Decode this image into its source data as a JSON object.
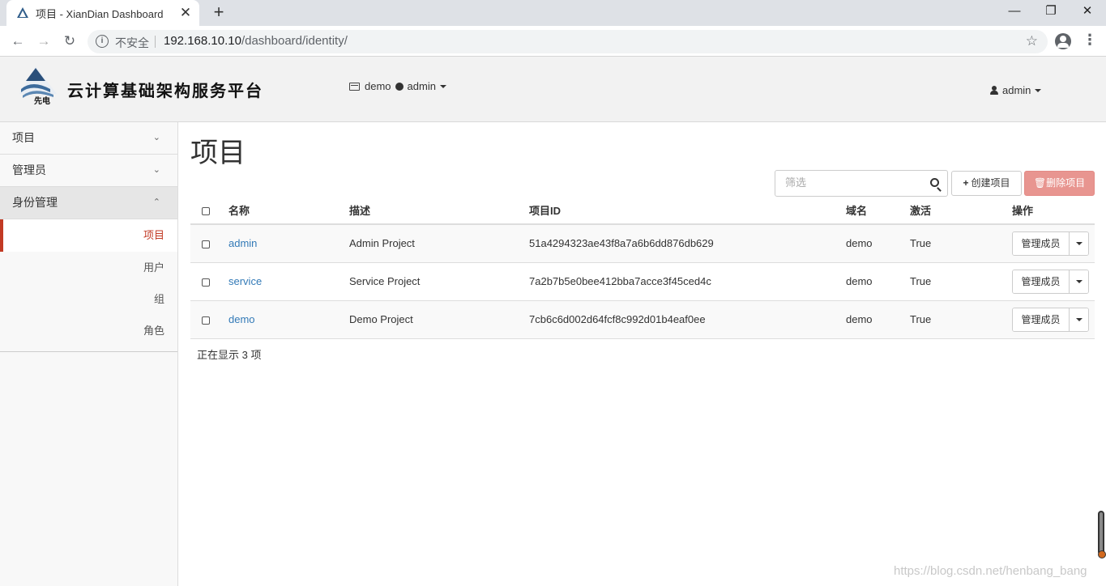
{
  "browser": {
    "tab_title": "项目 - XianDian Dashboard",
    "tab_close": "✕",
    "new_tab": "+",
    "window_minimize": "—",
    "window_restore": "❐",
    "window_close": "✕",
    "back": "←",
    "forward": "→",
    "reload": "↻",
    "security_label": "不安全",
    "url_host": "192.168.10.10",
    "url_path": "/dashboard/identity/",
    "bookmark": "☆",
    "menu": "⋮"
  },
  "header": {
    "brand": "云计算基础架构服务平台",
    "logo_text": "先电",
    "project": "demo",
    "region_user": "admin",
    "user": "admin"
  },
  "sidebar": {
    "sections": [
      {
        "label": "项目",
        "chevron": "⌄"
      },
      {
        "label": "管理员",
        "chevron": "⌄"
      },
      {
        "label": "身份管理",
        "chevron": "⌃"
      }
    ],
    "items": [
      {
        "label": "项目"
      },
      {
        "label": "用户"
      },
      {
        "label": "组"
      },
      {
        "label": "角色"
      }
    ]
  },
  "main": {
    "title": "项目",
    "filter_placeholder": "筛选",
    "create_label": "创建项目",
    "delete_label": "删除项目",
    "columns": [
      "名称",
      "描述",
      "项目ID",
      "域名",
      "激活",
      "操作"
    ],
    "rows": [
      {
        "name": "admin",
        "description": "Admin Project",
        "id": "51a4294323ae43f8a7a6b6dd876db629",
        "domain": "demo",
        "enabled": "True",
        "action": "管理成员"
      },
      {
        "name": "service",
        "description": "Service Project",
        "id": "7a2b7b5e0bee412bba7acce3f45ced4c",
        "domain": "demo",
        "enabled": "True",
        "action": "管理成员"
      },
      {
        "name": "demo",
        "description": "Demo Project",
        "id": "7cb6c6d002d64fcf8c992d01b4eaf0ee",
        "domain": "demo",
        "enabled": "True",
        "action": "管理成员"
      }
    ],
    "count_text": "正在显示 3 项"
  },
  "watermark": "https://blog.csdn.net/henbang_bang",
  "colors": {
    "accent": "#c23a24",
    "link": "#337ab7",
    "danger_button": "#e89590"
  }
}
